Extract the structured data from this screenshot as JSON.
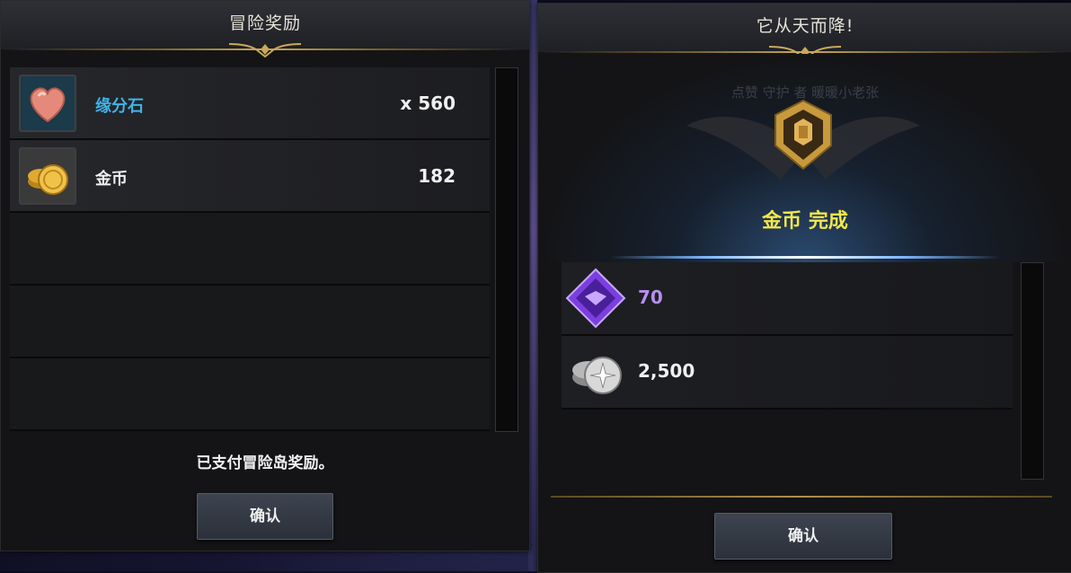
{
  "left_panel": {
    "title": "冒险奖励",
    "rewards": [
      {
        "icon": "heart-stone-icon",
        "name": "缘分石",
        "qty": "x 560",
        "name_color": "#3fb4ea"
      },
      {
        "icon": "gold-coin-icon",
        "name": "金币",
        "qty": "182",
        "name_color": "#f0f0f0"
      }
    ],
    "message": "已支付冒险岛奖励。",
    "confirm_label": "确认"
  },
  "right_panel": {
    "title": "它从天而降!",
    "faded_text": "点赞 守护 者 暖暖小老张",
    "badge_icon": "gold-rank-badge-icon",
    "badge_text": "金币 完成",
    "rewards": [
      {
        "icon": "purple-gem-icon",
        "qty": "70",
        "qty_color": "#b68ff0"
      },
      {
        "icon": "silver-coin-icon",
        "qty": "2,500",
        "qty_color": "#f0f0f0"
      }
    ],
    "confirm_label": "确认"
  }
}
